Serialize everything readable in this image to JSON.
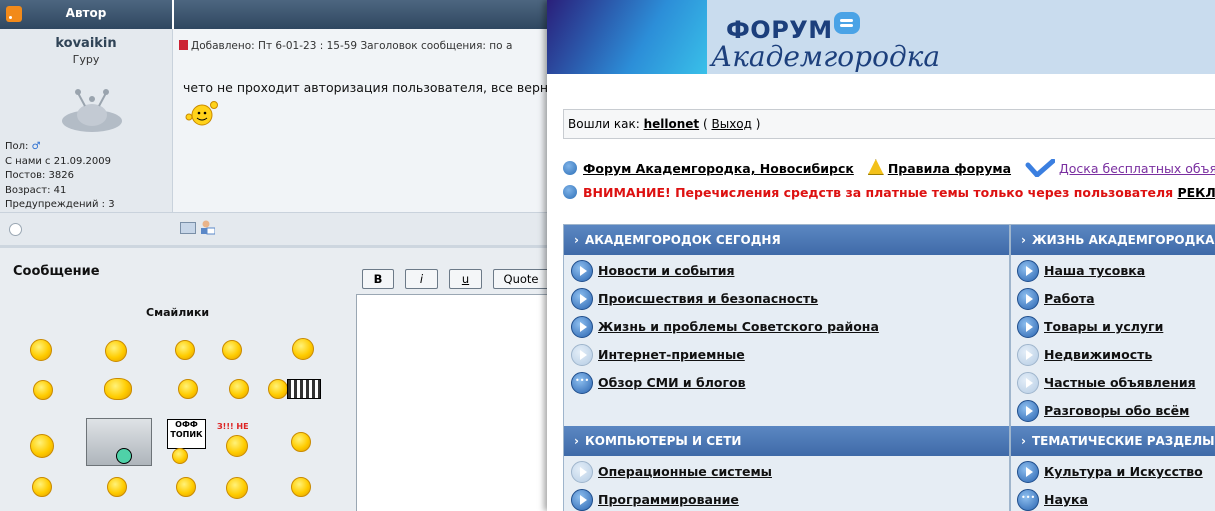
{
  "left_window": {
    "header_author": "Автор",
    "user": {
      "name": "kovaikin",
      "rank": "Гуру",
      "gender_label": "Пол:",
      "gender_icon": "♂",
      "joined": "С нами с 21.09.2009",
      "posts": "Постов: 3826",
      "age": "Возраст: 41",
      "warnings": "Предупреждений : 3"
    },
    "post": {
      "meta": "Добавлено: Пт 6-01-23 : 15-59     Заголовок сообщения: по а",
      "body": "чето не проходит авторизация пользователя, все верн"
    },
    "message_label": "Сообщение",
    "smiles_label": "Смайлики",
    "format_buttons": {
      "bold": "B",
      "italic": "i",
      "underline": "u",
      "quote": "Quote"
    },
    "smiley_signs": {
      "off_topic": "ОФФ ТОПИК",
      "ne": "З!!! НЕ"
    }
  },
  "right_window": {
    "banner": {
      "word1": "ФОРУМ",
      "word2": "Академгородка"
    },
    "login": {
      "prefix": "Вошли как:",
      "username": "hellonet",
      "open": "(",
      "logout": "Выход",
      "close": ")"
    },
    "links": {
      "home": "Форум Академгородка, Новосибирск",
      "rules": "Правила форума",
      "board": "Доска бесплатных объяв"
    },
    "notice": {
      "text": "ВНИМАНИЕ! Перечисления средств за платные темы только через пользователя ",
      "user": "РЕКЛАМА"
    },
    "categories": [
      {
        "title": "АКАДЕМГОРОДОК СЕГОДНЯ",
        "forums": [
          "Новости и события",
          "Происшествия и безопасность",
          "Жизнь и проблемы Советского района",
          "Интернет-приемные",
          "Обзор СМИ и блогов"
        ]
      },
      {
        "title": "ЖИЗНЬ АКАДЕМГОРОДКА",
        "forums": [
          "Наша тусовка",
          "Работа",
          "Товары и услуги",
          "Недвижимость",
          "Частные объявления",
          "Разговоры обо всём"
        ]
      },
      {
        "title": "КОМПЬЮТЕРЫ И СЕТИ",
        "forums": [
          "Операционные системы",
          "Программирование"
        ]
      },
      {
        "title": "ТЕМАТИЧЕСКИЕ РАЗДЕЛЫ",
        "forums": [
          "Культура и Искусство",
          "Наука"
        ]
      }
    ]
  }
}
